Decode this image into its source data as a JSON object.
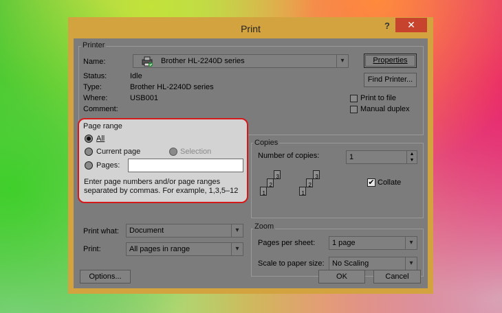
{
  "dialog": {
    "title": "Print",
    "help": "?",
    "close": "✕"
  },
  "printer": {
    "group_label": "Printer",
    "name_label": "Name:",
    "name_value": "Brother HL-2240D series",
    "status_label": "Status:",
    "status_value": "Idle",
    "type_label": "Type:",
    "type_value": "Brother HL-2240D series",
    "where_label": "Where:",
    "where_value": "USB001",
    "comment_label": "Comment:",
    "properties_button": "Properties",
    "find_printer_button": "Find Printer...",
    "print_to_file": "Print to file",
    "print_to_file_checked": false,
    "manual_duplex": "Manual duplex",
    "manual_duplex_checked": false
  },
  "page_range": {
    "group_label": "Page range",
    "all": "All",
    "current_page": "Current page",
    "selection": "Selection",
    "pages": "Pages:",
    "pages_value": "",
    "selected": "All",
    "hint": "Enter page numbers and/or page ranges separated by commas.  For example, 1,3,5–12"
  },
  "copies": {
    "group_label": "Copies",
    "number_label": "Number of copies:",
    "number_value": "1",
    "collate": "Collate",
    "collate_checked": true,
    "stack1_numbers": [
      "3",
      "2",
      "1"
    ],
    "stack2_numbers": [
      "3",
      "2",
      "1"
    ]
  },
  "print_what": {
    "label": "Print what:",
    "value": "Document"
  },
  "print": {
    "label": "Print:",
    "value": "All pages in range"
  },
  "zoom": {
    "group_label": "Zoom",
    "pages_per_sheet_label": "Pages per sheet:",
    "pages_per_sheet_value": "1 page",
    "scale_label": "Scale to paper size:",
    "scale_value": "No Scaling"
  },
  "footer": {
    "options": "Options...",
    "ok": "OK",
    "cancel": "Cancel"
  },
  "colors": {
    "highlight_border": "#d4191a",
    "title_bar": "#d2a33f",
    "close_button": "#c7432d"
  }
}
